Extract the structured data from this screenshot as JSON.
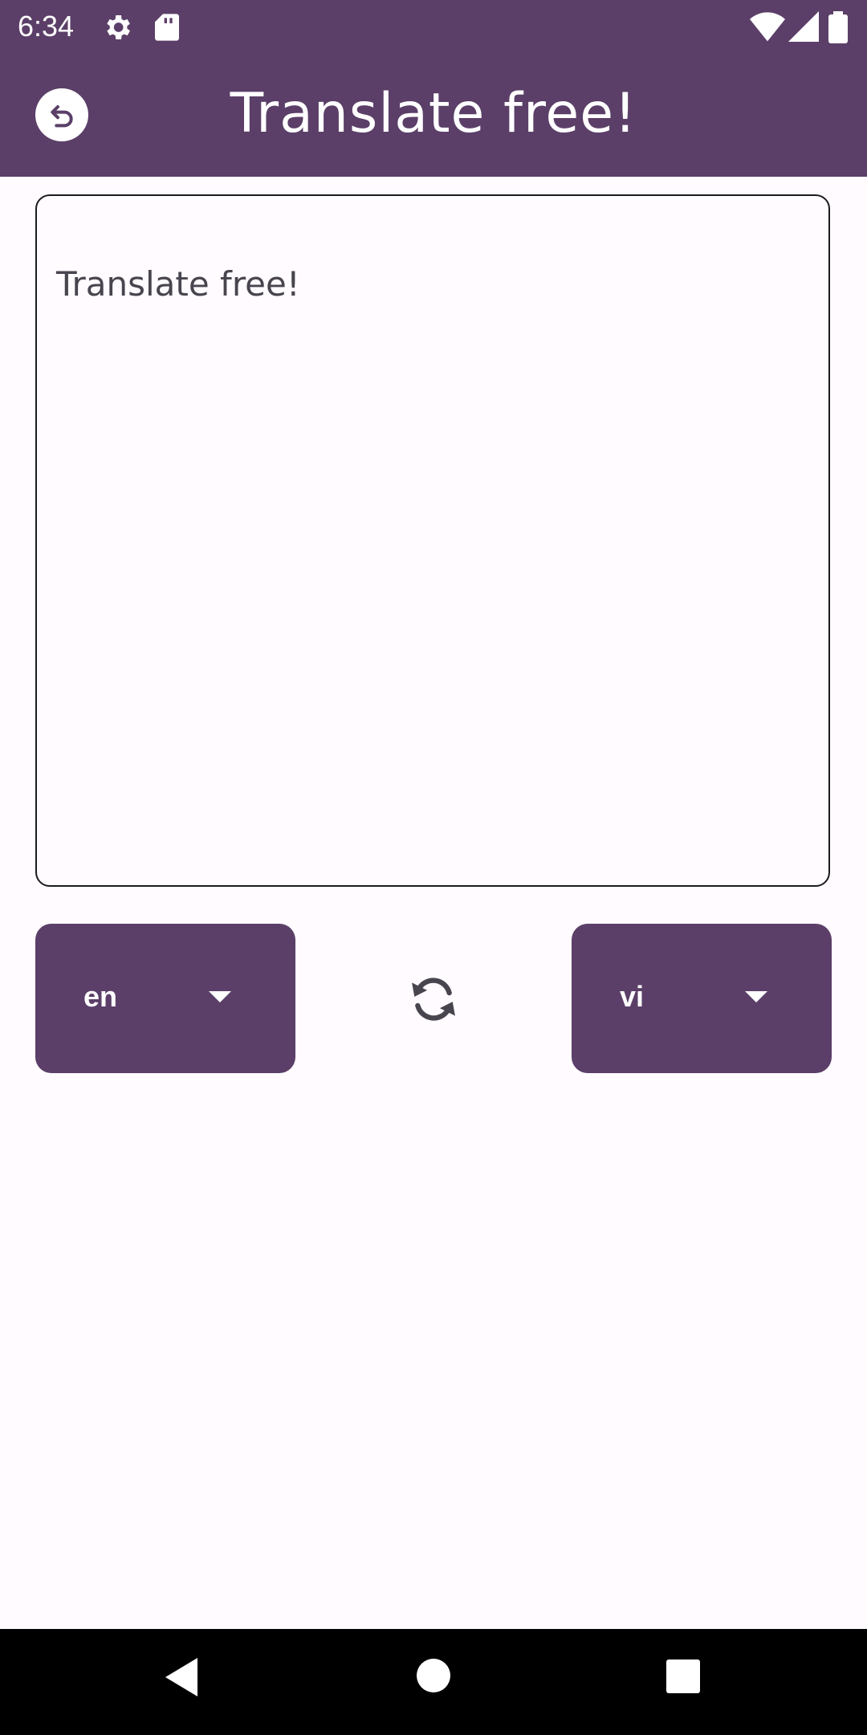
{
  "status_bar": {
    "time": "6:34",
    "icons": [
      "gear-icon",
      "sd-card-icon",
      "wifi-icon",
      "signal-icon",
      "battery-icon"
    ]
  },
  "app_bar": {
    "title": "Translate free!",
    "back_icon": "back-arrow-icon"
  },
  "input": {
    "text": "Translate free!"
  },
  "languages": {
    "source": "en",
    "target": "vi",
    "swap_icon": "swap-sync-icon"
  },
  "nav_bar": {
    "icons": [
      "back-triangle-icon",
      "home-circle-icon",
      "recents-square-icon"
    ]
  },
  "colors": {
    "primary": "#5b3f68",
    "background": "#fffbff",
    "text": "#49454f",
    "outline": "#1c1b1f"
  }
}
